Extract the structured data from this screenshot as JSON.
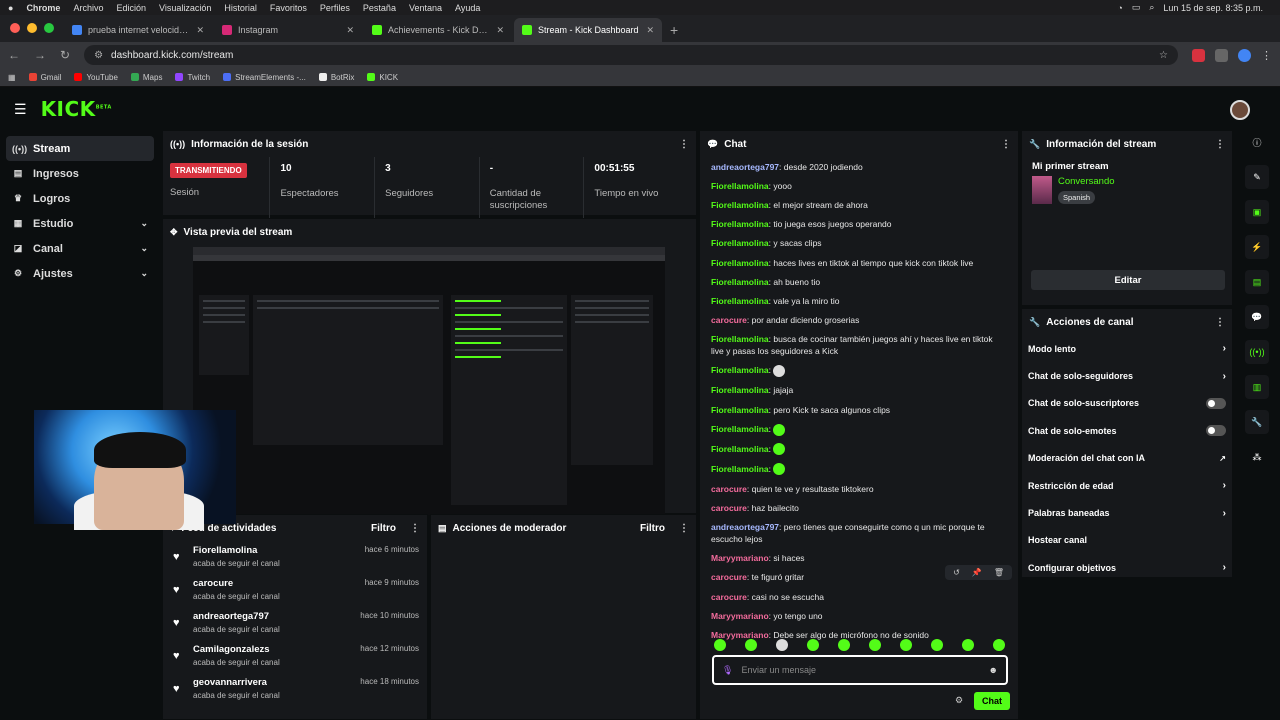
{
  "menubar": {
    "app": "Chrome",
    "items": [
      "Archivo",
      "Edición",
      "Visualización",
      "Historial",
      "Favoritos",
      "Perfiles",
      "Pestaña",
      "Ventana",
      "Ayuda"
    ],
    "datetime": "Lun 15 de sep.  8:35 p.m."
  },
  "tabs": [
    {
      "title": "prueba internet velocidad - B",
      "fav": "#4285f4"
    },
    {
      "title": "Instagram",
      "fav": "#d62976"
    },
    {
      "title": "Achievements - Kick Dashboard",
      "fav": "#53fc18"
    },
    {
      "title": "Stream - Kick Dashboard",
      "fav": "#53fc18"
    }
  ],
  "address": {
    "url": "dashboard.kick.com/stream"
  },
  "bookmarks": [
    {
      "label": "Gmail",
      "color": "#ea4335"
    },
    {
      "label": "YouTube",
      "color": "#ff0000"
    },
    {
      "label": "Maps",
      "color": "#34a853"
    },
    {
      "label": "Twitch",
      "color": "#9146ff"
    },
    {
      "label": "StreamElements -...",
      "color": "#4c6ef5"
    },
    {
      "label": "BotRix",
      "color": "#eeeeee"
    },
    {
      "label": "KICK",
      "color": "#53fc18"
    }
  ],
  "kick": {
    "logo": "KICK",
    "beta": "BETA"
  },
  "nav": [
    {
      "label": "Stream",
      "icon": "((•))",
      "chevron": ""
    },
    {
      "label": "Ingresos",
      "icon": "▤",
      "chevron": ""
    },
    {
      "label": "Logros",
      "icon": "♛",
      "chevron": ""
    },
    {
      "label": "Estudio",
      "icon": "▦",
      "chevron": "⌄"
    },
    {
      "label": "Canal",
      "icon": "◪",
      "chevron": "⌄"
    },
    {
      "label": "Ajustes",
      "icon": "⚙",
      "chevron": "⌄"
    }
  ],
  "session": {
    "title": "Información de la sesión",
    "live": "TRANSMITIENDO",
    "live_label": "Sesión",
    "stats": [
      {
        "value": "10",
        "label": "Espectadores"
      },
      {
        "value": "3",
        "label": "Seguidores"
      },
      {
        "value": "-",
        "label": "Cantidad de suscripciones"
      },
      {
        "value": "00:51:55",
        "label": "Tiempo en vivo"
      }
    ]
  },
  "preview": {
    "title": "Vista previa del stream"
  },
  "feed": {
    "title": "Feed de actividades",
    "filter": "Filtro",
    "items": [
      {
        "name": "Fiorellamolina",
        "sub": "acaba de seguir el canal",
        "time": "hace 6 minutos"
      },
      {
        "name": "carocure",
        "sub": "acaba de seguir el canal",
        "time": "hace 9 minutos"
      },
      {
        "name": "andreaortega797",
        "sub": "acaba de seguir el canal",
        "time": "hace 10 minutos"
      },
      {
        "name": "Camilagonzalezs",
        "sub": "acaba de seguir el canal",
        "time": "hace 12 minutos"
      },
      {
        "name": "geovannarrivera",
        "sub": "acaba de seguir el canal",
        "time": "hace 18 minutos"
      }
    ]
  },
  "mod": {
    "title": "Acciones de moderador",
    "filter": "Filtro"
  },
  "chat": {
    "title": "Chat",
    "placeholder": "Enviar un mensaje",
    "send": "Chat",
    "messages": [
      {
        "user": "andreaortega797",
        "color": "blue",
        "text": "desde 2020 jodiendo"
      },
      {
        "user": "Fiorellamolina",
        "color": "green",
        "text": "yooo"
      },
      {
        "user": "Fiorellamolina",
        "color": "green",
        "text": "el mejor stream de ahora"
      },
      {
        "user": "Fiorellamolina",
        "color": "green",
        "text": "tio juega esos juegos operando"
      },
      {
        "user": "Fiorellamolina",
        "color": "green",
        "text": "y sacas clips"
      },
      {
        "user": "Fiorellamolina",
        "color": "green",
        "text": "haces lives en tiktok al tiempo que kick con tiktok live"
      },
      {
        "user": "Fiorellamolina",
        "color": "green",
        "text": "ah bueno tio"
      },
      {
        "user": "Fiorellamolina",
        "color": "green",
        "text": "vale ya la miro tio"
      },
      {
        "user": "carocure",
        "color": "pink",
        "text": "por andar diciendo groserias"
      },
      {
        "user": "Fiorellamolina",
        "color": "green",
        "text": "busca de cocinar también juegos ahí y haces live en tiktok live y pasas los seguidores a Kick"
      },
      {
        "user": "Fiorellamolina",
        "color": "green",
        "text": "",
        "emote": "w"
      },
      {
        "user": "Fiorellamolina",
        "color": "green",
        "text": "jajaja"
      },
      {
        "user": "Fiorellamolina",
        "color": "green",
        "text": "pero Kick te saca algunos clips"
      },
      {
        "user": "Fiorellamolina",
        "color": "green",
        "text": "",
        "emote": "g"
      },
      {
        "user": "Fiorellamolina",
        "color": "green",
        "text": "",
        "emote": "g"
      },
      {
        "user": "Fiorellamolina",
        "color": "green",
        "text": "",
        "emote": "g"
      },
      {
        "user": "carocure",
        "color": "pink",
        "text": "quien te ve y resultaste tiktokero"
      },
      {
        "user": "carocure",
        "color": "pink",
        "text": "haz bailecito"
      },
      {
        "user": "andreaortega797",
        "color": "blue",
        "text": "pero tienes que conseguirte como q un mic porque te escucho lejos"
      },
      {
        "user": "Maryymariano",
        "color": "pink",
        "text": "si haces"
      },
      {
        "user": "carocure",
        "color": "pink",
        "text": "te figuró gritar"
      },
      {
        "user": "carocure",
        "color": "pink",
        "text": "casi no se escucha"
      },
      {
        "user": "Maryymariano",
        "color": "pink",
        "text": "yo tengo uno"
      },
      {
        "user": "Maryymariano",
        "color": "pink",
        "text": "Debe ser algo de micrófono no de sonido"
      }
    ]
  },
  "streaminfo": {
    "title": "Información del stream",
    "name": "Mi primer stream",
    "category": "Conversando",
    "lang": "Spanish",
    "edit": "Editar"
  },
  "actions": {
    "title": "Acciones de canal",
    "items": [
      {
        "label": "Modo lento",
        "type": "arrow"
      },
      {
        "label": "Chat de solo-seguidores",
        "type": "arrow"
      },
      {
        "label": "Chat de solo-suscriptores",
        "type": "toggle"
      },
      {
        "label": "Chat de solo-emotes",
        "type": "toggle"
      },
      {
        "label": "Moderación del chat con IA",
        "type": "ext"
      },
      {
        "label": "Restricción de edad",
        "type": "arrow"
      },
      {
        "label": "Palabras baneadas",
        "type": "arrow"
      },
      {
        "label": "Hostear canal",
        "type": "none"
      },
      {
        "label": "Configurar objetivos",
        "type": "arrow"
      }
    ]
  },
  "colors": {
    "accent": "#53fc18",
    "live": "#d8323f",
    "panel": "#16181b"
  }
}
